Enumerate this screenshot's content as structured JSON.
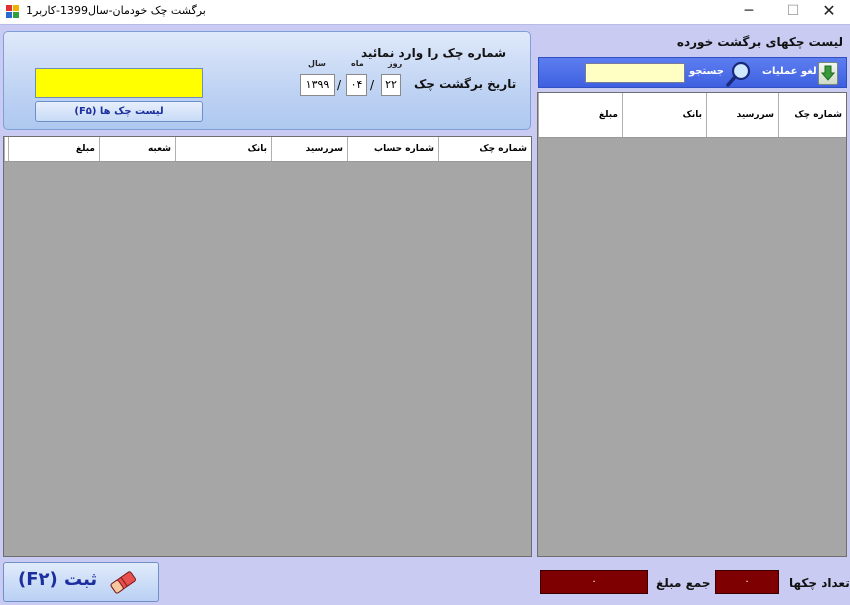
{
  "window": {
    "title": "برگشت چک خودمان-سال1399-کاربر1",
    "minimize": "─",
    "maximize": "☐",
    "close": "✕"
  },
  "entry": {
    "prompt": "شماره چک را وارد نمائید",
    "check_input_value": "",
    "list_button": "لیست چک ها  (F۵)"
  },
  "date": {
    "label": "تاریخ برگشت چک",
    "day_label": "روز",
    "month_label": "ماه",
    "year_label": "سال",
    "day": "۲۲",
    "month": "۰۴",
    "year": "۱۳۹۹",
    "separator": "/"
  },
  "main_grid": {
    "columns": [
      "شماره چک",
      "شماره حساب",
      "سررسید",
      "بانک",
      "شعبه",
      "مبلغ"
    ]
  },
  "returned_list": {
    "title": "لیست چکهای برگشت خورده",
    "undo_label": "لغو عملیات",
    "search_label": "جستجو",
    "search_value": "",
    "columns": [
      "شماره چک",
      "سررسید",
      "بانک",
      "مبلغ"
    ]
  },
  "footer": {
    "submit_label": "ثبت (F۲)",
    "count_label": "تعداد چکها",
    "count_value": "۰",
    "sum_label": "جمع مبلغ",
    "sum_value": "۰"
  },
  "colors": {
    "background": "#c9cbf2",
    "grid_body": "#a6a6a6",
    "highlight_input": "#ffff00",
    "total_box": "#7f0000",
    "toolbar": "#4a6ae6",
    "button_text": "#1c2f9e"
  }
}
